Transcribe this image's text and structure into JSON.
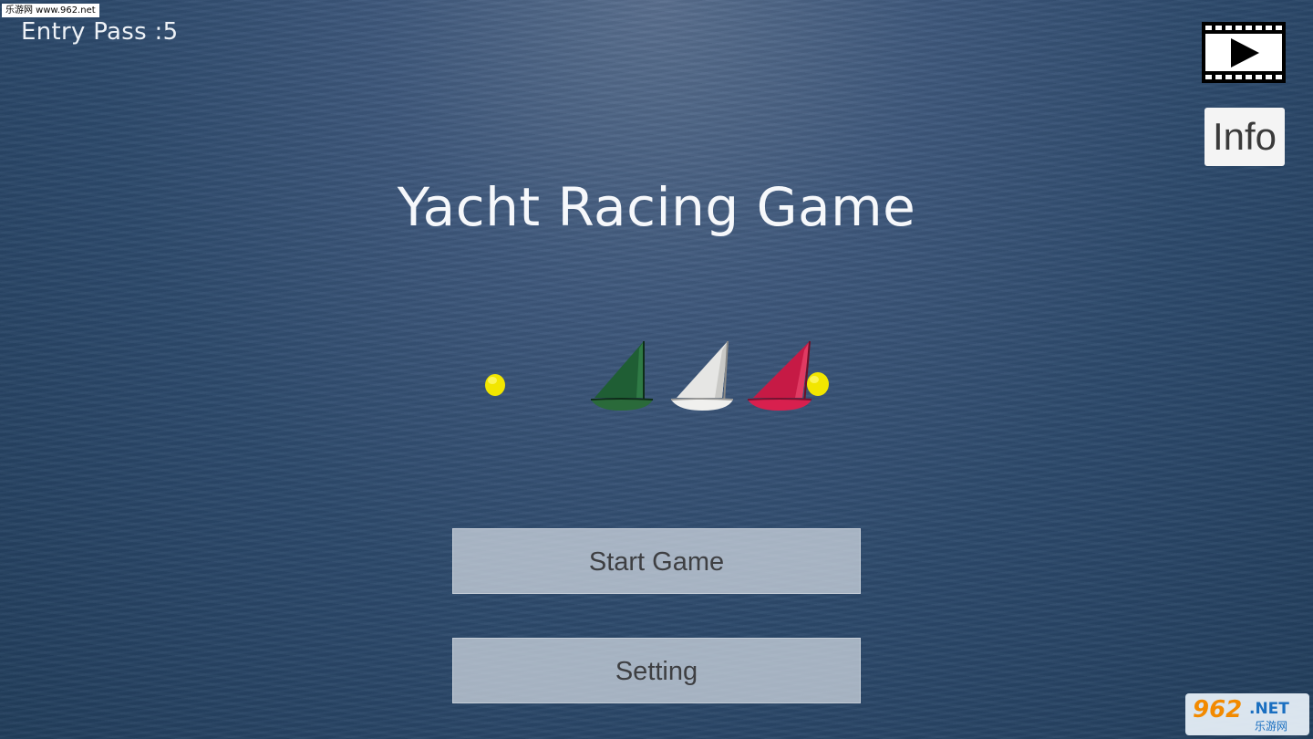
{
  "watermark": {
    "top_text": "乐游网 www.962.net",
    "logo_number": "962",
    "logo_suffix": ".NET",
    "logo_chinese": "乐游网"
  },
  "hud": {
    "entry_pass": "Entry Pass :5"
  },
  "topright": {
    "video_icon": "film-play-icon",
    "info_label": "Info"
  },
  "title": "Yacht Racing Game",
  "scene": {
    "buoys": [
      "yellow",
      "yellow"
    ],
    "boats": [
      {
        "sail_color": "#1f5e34",
        "hull_color": "#2a6a3a"
      },
      {
        "sail_color": "#e6e6e4",
        "hull_color": "#f0f0ee"
      },
      {
        "sail_color": "#c61a45",
        "hull_color": "#d8204e"
      }
    ]
  },
  "menu": {
    "start_label": "Start Game",
    "setting_label": "Setting"
  },
  "colors": {
    "sea": "#2d4a6c",
    "buoy": "#f2e600",
    "button_bg": "#d6dce4"
  }
}
